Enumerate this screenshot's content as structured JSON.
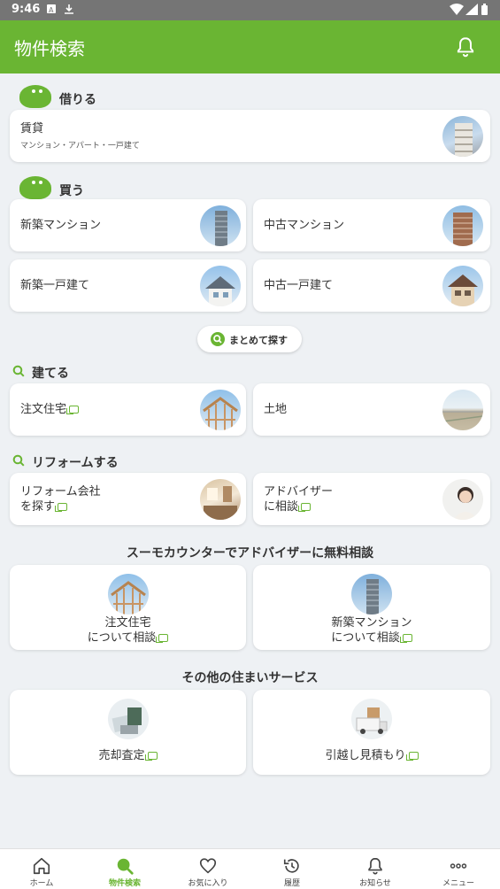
{
  "status": {
    "time": "9:46"
  },
  "appbar": {
    "title": "物件検索"
  },
  "rent": {
    "heading": "借りる",
    "card": {
      "label": "賃貸",
      "sub": "マンション・アパート・一戸建て"
    }
  },
  "buy": {
    "heading": "買う",
    "cards": [
      {
        "label": "新築マンション"
      },
      {
        "label": "中古マンション"
      },
      {
        "label": "新築一戸建て"
      },
      {
        "label": "中古一戸建て"
      }
    ],
    "search_all": "まとめて探す"
  },
  "build": {
    "heading": "建てる",
    "cards": [
      {
        "label": "注文住宅"
      },
      {
        "label": "土地"
      }
    ]
  },
  "reform": {
    "heading": "リフォームする",
    "cards": [
      {
        "line1": "リフォーム会社",
        "line2": "を探す"
      },
      {
        "line1": "アドバイザー",
        "line2": "に相談"
      }
    ]
  },
  "counter": {
    "heading": "スーモカウンターでアドバイザーに無料相談",
    "cards": [
      {
        "line1": "注文住宅",
        "line2": "について相談"
      },
      {
        "line1": "新築マンション",
        "line2": "について相談"
      }
    ]
  },
  "other": {
    "heading": "その他の住まいサービス",
    "cards": [
      {
        "label": "売却査定"
      },
      {
        "label": "引越し見積もり"
      }
    ]
  },
  "nav": [
    {
      "label": "ホーム",
      "icon": "home-icon"
    },
    {
      "label": "物件検索",
      "icon": "search-icon",
      "active": true
    },
    {
      "label": "お気に入り",
      "icon": "heart-icon"
    },
    {
      "label": "履歴",
      "icon": "history-icon"
    },
    {
      "label": "お知らせ",
      "icon": "bell-icon"
    },
    {
      "label": "メニュー",
      "icon": "more-icon"
    }
  ],
  "colors": {
    "brand_green": "#6ab533",
    "background": "#eef1f4"
  }
}
